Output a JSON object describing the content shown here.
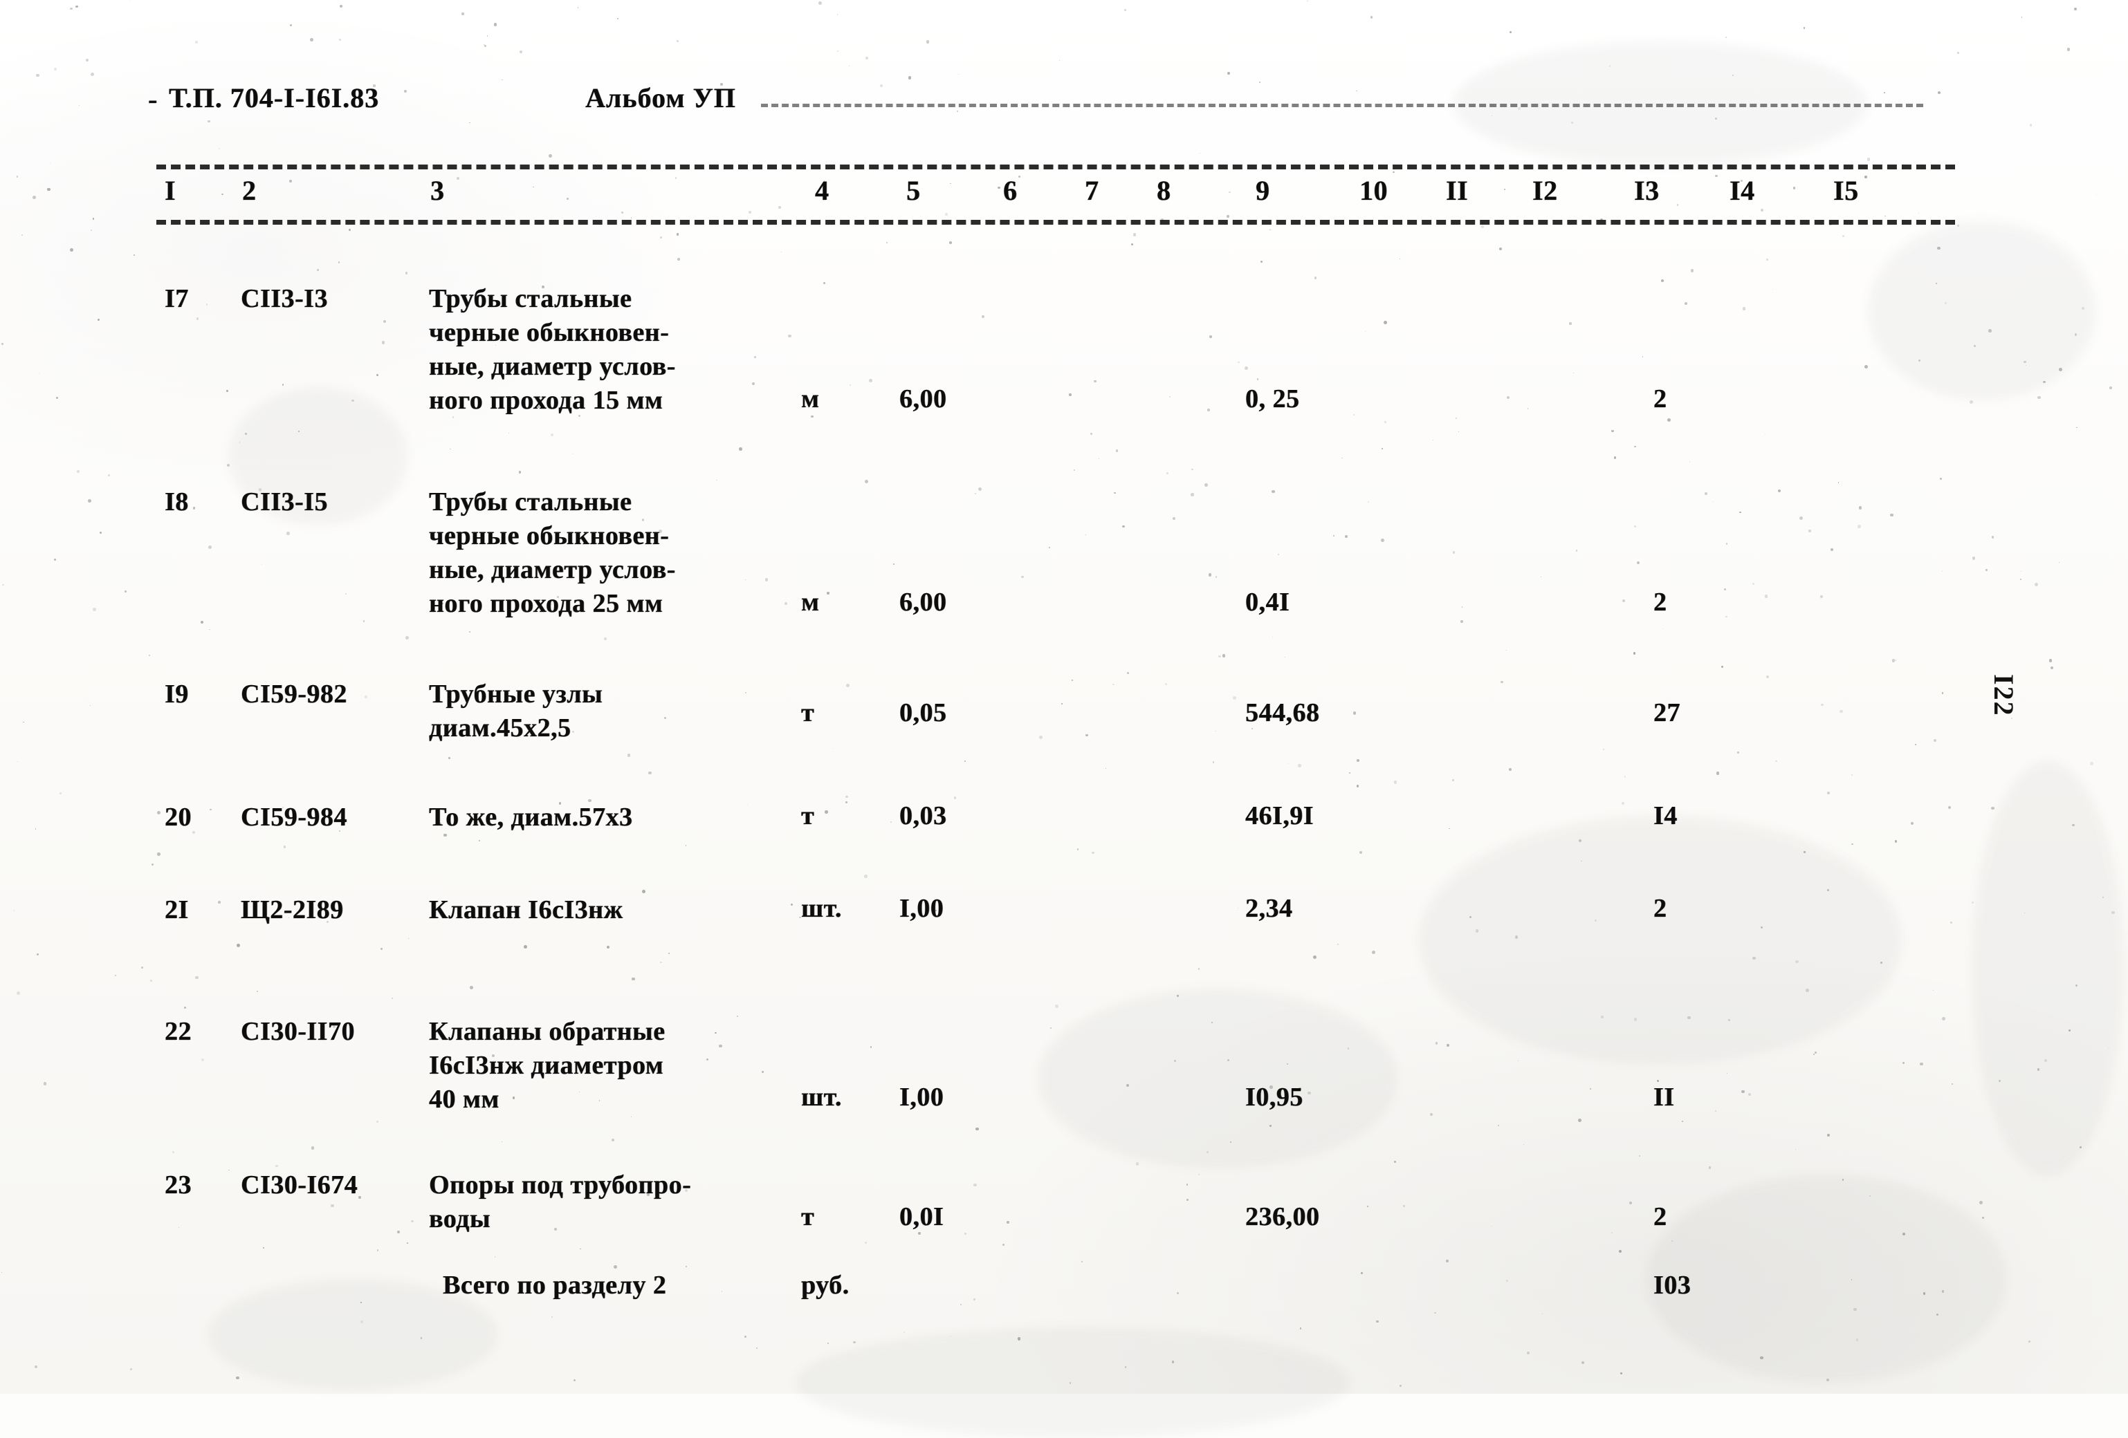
{
  "document": {
    "header": {
      "project_code": "Т.П. 704-I-I6I.83",
      "album": "Альбом УП"
    },
    "page_number": "I22",
    "column_numbers": [
      "I",
      "2",
      "3",
      "4",
      "5",
      "6",
      "7",
      "8",
      "9",
      "10",
      "II",
      "I2",
      "I3",
      "I4",
      "I5"
    ],
    "rows": [
      {
        "no": "I7",
        "code": "СII3-I3",
        "description_lines": [
          "Трубы стальные",
          "черные обыкновен-",
          "ные, диаметр услов-",
          "ного прохода 15 мм"
        ],
        "unit": "м",
        "qty": "6,00",
        "price": "0, 25",
        "total": "2"
      },
      {
        "no": "I8",
        "code": "СII3-I5",
        "description_lines": [
          "Трубы стальные",
          "черные обыкновен-",
          "ные, диаметр услов-",
          "ного прохода 25 мм"
        ],
        "unit": "м",
        "qty": "6,00",
        "price": "0,4I",
        "total": "2"
      },
      {
        "no": "I9",
        "code": "СI59-982",
        "description_lines": [
          "Трубные узлы",
          "диам.45х2,5"
        ],
        "unit": "т",
        "qty": "0,05",
        "price": "544,68",
        "total": "27"
      },
      {
        "no": "20",
        "code": "СI59-984",
        "description_lines": [
          "То же, диам.57х3"
        ],
        "unit": "т",
        "qty": "0,03",
        "price": "46I,9I",
        "total": "I4"
      },
      {
        "no": "2I",
        "code": "Щ2-2I89",
        "description_lines": [
          "Клапан I6сI3нж"
        ],
        "unit": "шт.",
        "qty": "I,00",
        "price": "2,34",
        "total": "2"
      },
      {
        "no": "22",
        "code": "СI30-II70",
        "description_lines": [
          "Клапаны обратные",
          "I6сI3нж диаметром",
          "40 мм"
        ],
        "unit": "шт.",
        "qty": "I,00",
        "price": "I0,95",
        "total": "II"
      },
      {
        "no": "23",
        "code": "СI30-I674",
        "description_lines": [
          "Опоры под трубопро-",
          "воды"
        ],
        "unit": "т",
        "qty": "0,0I",
        "price": "236,00",
        "total": "2"
      }
    ],
    "summary": {
      "label": "Всего по разделу 2",
      "unit": "руб.",
      "total": "I03"
    }
  }
}
